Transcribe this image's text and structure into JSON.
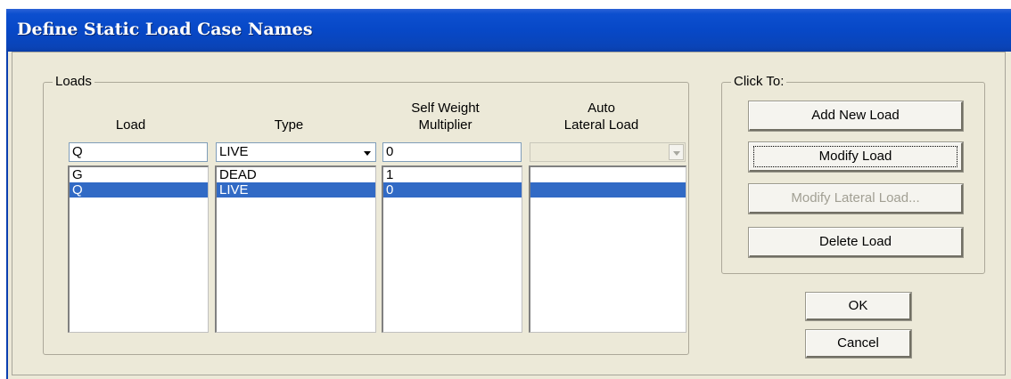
{
  "window": {
    "title": "Define Static Load Case Names"
  },
  "loads_group": {
    "legend": "Loads",
    "headers": {
      "load": "Load",
      "type": "Type",
      "self_weight_line1": "Self Weight",
      "self_weight_line2": "Multiplier",
      "auto_line1": "Auto",
      "auto_line2": "Lateral Load"
    },
    "inputs": {
      "load_name": "Q",
      "type_selected": "LIVE",
      "self_weight": "0",
      "auto_lateral": ""
    },
    "rows": [
      {
        "load": "G",
        "type": "DEAD",
        "self_weight": "1",
        "auto_lateral": "",
        "selected": false
      },
      {
        "load": "Q",
        "type": "LIVE",
        "self_weight": "0",
        "auto_lateral": "",
        "selected": true
      }
    ]
  },
  "click_to_group": {
    "legend": "Click To:",
    "buttons": {
      "add": "Add New Load",
      "modify": "Modify Load",
      "modify_lateral": "Modify Lateral Load...",
      "delete": "Delete Load"
    }
  },
  "dialog_buttons": {
    "ok": "OK",
    "cancel": "Cancel"
  },
  "icons": {
    "type_dropdown": "chevron-down-icon",
    "auto_dropdown": "chevron-down-icon"
  },
  "colors": {
    "title_bar": "#0748c7",
    "selection": "#316ac5",
    "dialog_bg": "#ece9d8"
  }
}
